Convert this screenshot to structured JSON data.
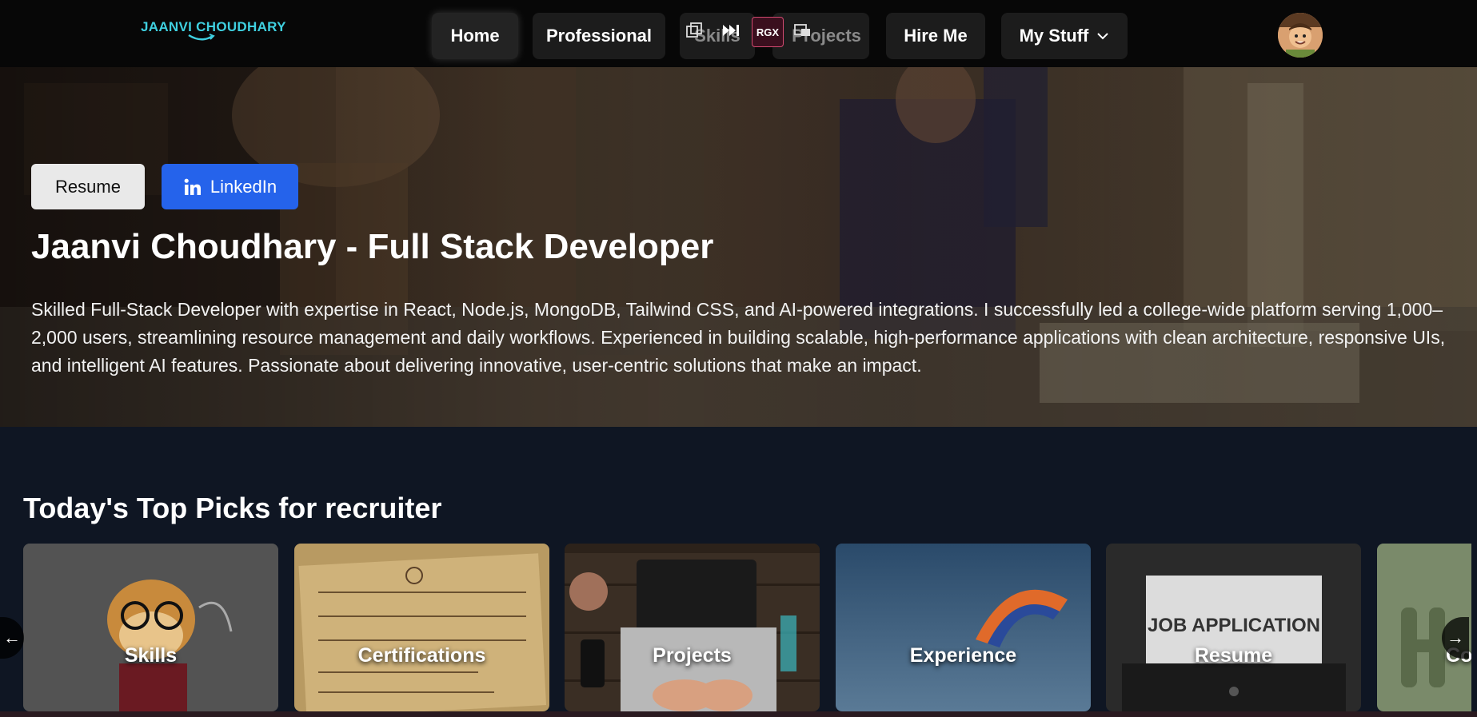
{
  "nav": {
    "logo": "JAANVI CHOUDHARY",
    "items": [
      {
        "label": "Home"
      },
      {
        "label": "Professional"
      },
      {
        "label": "Skills"
      },
      {
        "label": "Projects"
      },
      {
        "label": "Hire Me"
      },
      {
        "label": "My Stuff"
      }
    ],
    "extension_badge": "RGX"
  },
  "hero": {
    "resume_label": "Resume",
    "linkedin_label": "LinkedIn",
    "title": "Jaanvi Choudhary - Full Stack Developer",
    "description": "Skilled Full-Stack Developer with expertise in React, Node.js, MongoDB, Tailwind CSS, and AI-powered integrations. I successfully led a college-wide platform serving 1,000–2,000 users, streamlining resource management and daily workflows. Experienced in building scalable, high-performance applications with clean architecture, responsive UIs, and intelligent AI features. Passionate about delivering innovative, user-centric solutions that make an impact."
  },
  "picks": {
    "title": "Today's Top Picks for recruiter",
    "cards": [
      {
        "label": "Skills"
      },
      {
        "label": "Certifications"
      },
      {
        "label": "Projects"
      },
      {
        "label": "Experience"
      },
      {
        "label": "Resume"
      },
      {
        "label": "Co"
      }
    ],
    "prev_arrow": "←",
    "next_arrow": "→"
  },
  "colors": {
    "accent": "#2563eb",
    "logo": "#3fd0e0",
    "background": "#0f1623"
  }
}
